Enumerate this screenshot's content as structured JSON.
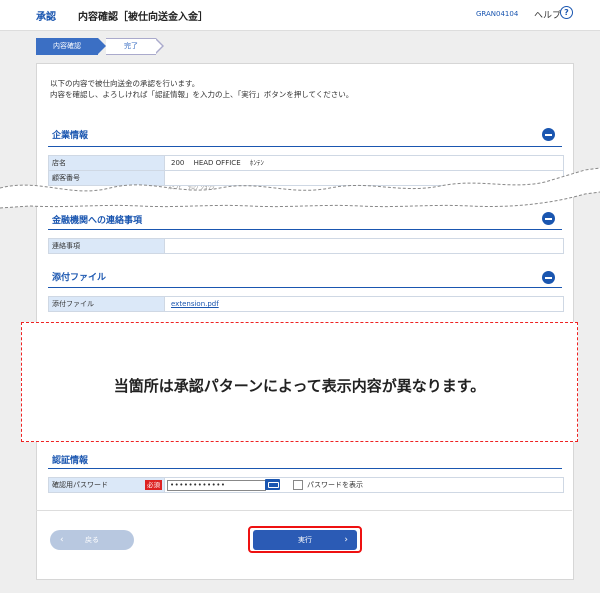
{
  "header": {
    "category": "承認",
    "title": "内容確認［被仕向送金入金］",
    "screen_code": "GRAN04104",
    "help_label": "ヘルプ",
    "help_icon": "question-circle-icon"
  },
  "steps": [
    {
      "label": "内容確認",
      "active": true
    },
    {
      "label": "完了",
      "active": false
    }
  ],
  "intro": {
    "line1": "以下の内容で被仕向送金の承認を行います。",
    "line2": "内容を確認し、よろしければ「認証情報」を入力の上、「実行」ボタンを押してください。"
  },
  "company": {
    "title": "企業情報",
    "rows": [
      {
        "label": "店名",
        "value": "200　 HEAD OFFICE　 ﾎﾝﾃﾝ"
      },
      {
        "label": "顧客番号",
        "value": ""
      }
    ],
    "partial_text": "ｽﾐﾝﾋﾞ ﾀﾛｳ ｼﾖｳｼﾞ"
  },
  "contact": {
    "title": "金融機関への連絡事項",
    "rows": [
      {
        "label": "連絡事項",
        "value": ""
      }
    ]
  },
  "attachments": {
    "title": "添付ファイル",
    "rows": [
      {
        "label": "添付ファイル",
        "value": "extension.pdf"
      }
    ]
  },
  "note": "当箇所は承認パターンによって表示内容が異なります。",
  "auth": {
    "title": "認証情報",
    "password_label": "確認用パスワード",
    "required_badge": "必須",
    "password_value": "••••••••••••",
    "show_password_label": "パスワードを表示"
  },
  "buttons": {
    "back": "戻る",
    "execute": "実行"
  },
  "colors": {
    "accent": "#1a56b0",
    "required": "#d22222",
    "highlight_outline": "#e11111"
  }
}
